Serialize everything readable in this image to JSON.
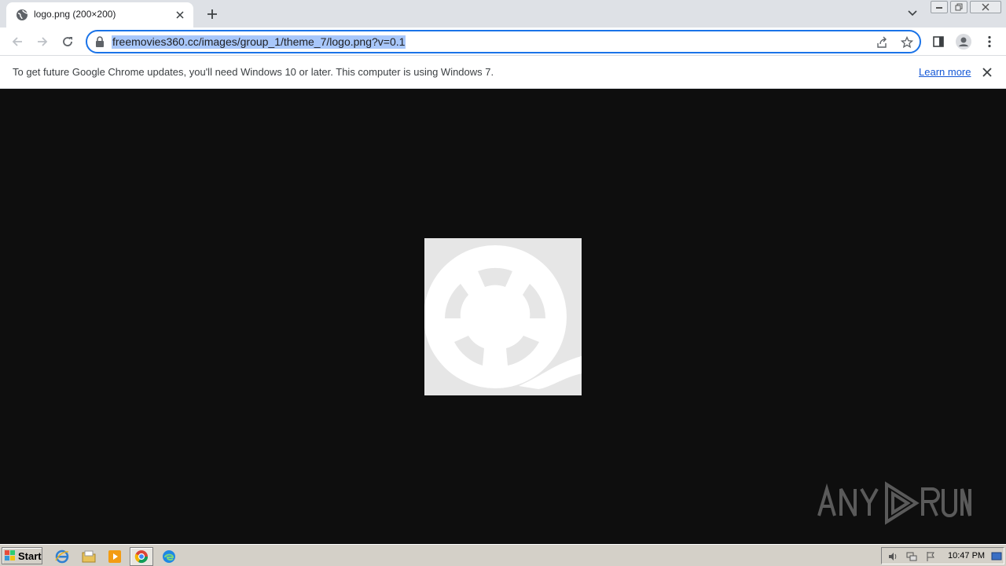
{
  "tab": {
    "title": "logo.png (200×200)",
    "favicon": "globe-icon"
  },
  "toolbar": {
    "url": "freemovies360.cc/images/group_1/theme_7/logo.png?v=0.1"
  },
  "infobar": {
    "message": "To get future Google Chrome updates, you'll need Windows 10 or later. This computer is using Windows 7.",
    "learn_more": "Learn more"
  },
  "content": {
    "image_desc": "film-reel-logo",
    "background": "#0e0e0e"
  },
  "taskbar": {
    "start_label": "Start",
    "clock": "10:47 PM"
  },
  "colors": {
    "accent": "#1a73e8",
    "selection": "#a8c7fa",
    "link": "#1558d6"
  }
}
